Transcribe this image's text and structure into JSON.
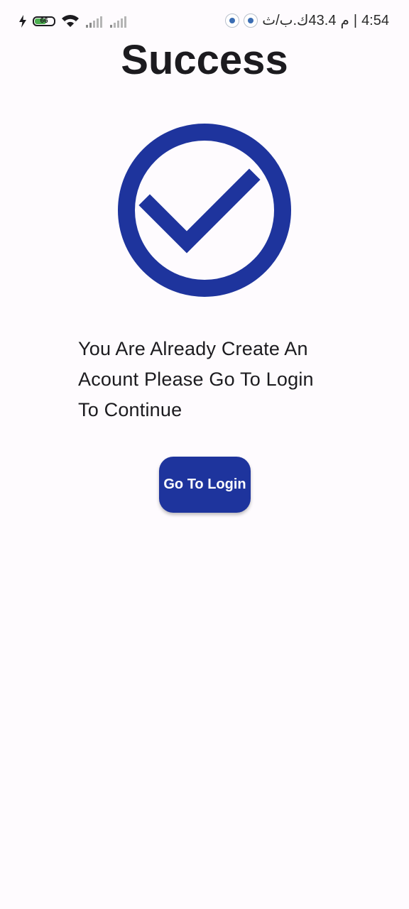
{
  "status_bar": {
    "battery_level": "66",
    "time": "4:54",
    "am_pm": "م",
    "separator": "|",
    "network_speed": "43.4ك.ب/ث",
    "icons": [
      "charging-bolt-icon",
      "battery-icon",
      "wifi-icon",
      "signal-icon",
      "signal-icon",
      "app-notification-icon",
      "app-notification-icon"
    ],
    "battery_color": "#4caf50"
  },
  "page": {
    "title": "Success",
    "icon": "check-circle-icon",
    "message": "You Are Already Create An Acount Please Go To Login To Continue",
    "accent_color": "#1e349d"
  },
  "actions": {
    "go_to_login_label": "Go To Login"
  }
}
